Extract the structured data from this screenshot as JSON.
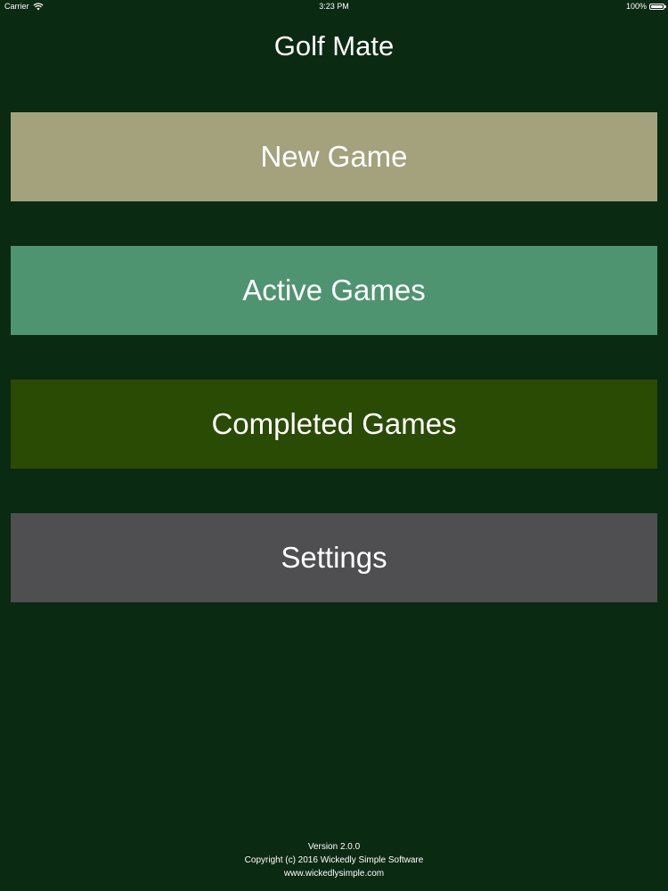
{
  "status_bar": {
    "carrier": "Carrier",
    "time": "3:23 PM",
    "battery_text": "100%",
    "battery_level": 1.0,
    "wifi_icon": "wifi-icon",
    "battery_icon": "battery-icon"
  },
  "app": {
    "title": "Golf Mate"
  },
  "menu": {
    "new_game": {
      "label": "New Game",
      "color": "#a3a27c"
    },
    "active_games": {
      "label": "Active Games",
      "color": "#4f9470"
    },
    "completed_games": {
      "label": "Completed Games",
      "color": "#2a4b04"
    },
    "settings": {
      "label": "Settings",
      "color": "#4f4e50"
    }
  },
  "footer": {
    "version": "Version 2.0.0",
    "copyright": "Copyright (c) 2016 Wickedly Simple Software",
    "website": "www.wickedlysimple.com"
  },
  "colors": {
    "background": "#0b2a12",
    "text": "#ffffff"
  }
}
